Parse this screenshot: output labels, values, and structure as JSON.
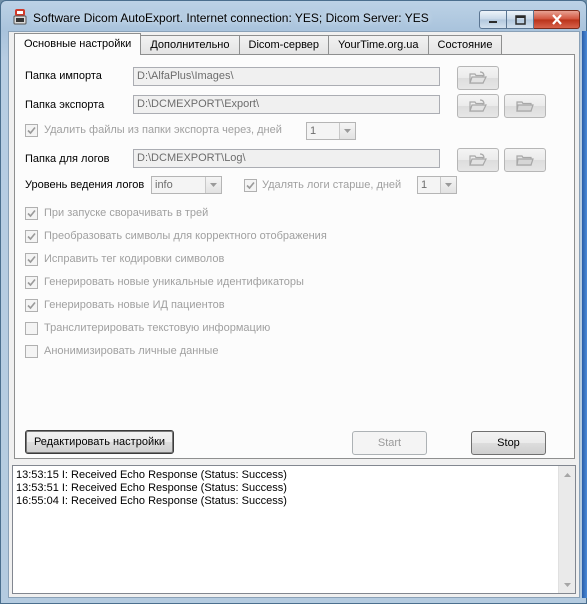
{
  "window": {
    "title": "Software Dicom AutoExport. Internet connection: YES; Dicom Server: YES"
  },
  "tabs": [
    {
      "label": "Основные настройки"
    },
    {
      "label": "Дополнительно"
    },
    {
      "label": "Dicom-сервер"
    },
    {
      "label": "YourTime.org.ua"
    },
    {
      "label": "Состояние"
    }
  ],
  "settings": {
    "import_folder": {
      "label": "Папка импорта",
      "value": "D:\\AlfaPlus\\Images\\"
    },
    "export_folder": {
      "label": "Папка экспорта",
      "value": "D:\\DCMEXPORT\\Export\\"
    },
    "delete_export": {
      "label": "Удалить файлы из папки экспорта через, дней",
      "days": "1",
      "checked": true
    },
    "log_folder": {
      "label": "Папка для логов",
      "value": "D:\\DCMEXPORT\\Log\\"
    },
    "log_level": {
      "label": "Уровень ведения логов",
      "value": "info"
    },
    "delete_logs": {
      "label": "Удалять логи старше, дней",
      "days": "1",
      "checked": true
    },
    "options": [
      {
        "label": "При запуске сворачивать в трей",
        "checked": true
      },
      {
        "label": "Преобразовать символы для корректного отображения",
        "checked": true
      },
      {
        "label": "Исправить тег кодировки символов",
        "checked": true
      },
      {
        "label": "Генерировать новые уникальные идентификаторы",
        "checked": true
      },
      {
        "label": "Генерировать новые ИД пациентов",
        "checked": true
      },
      {
        "label": "Транслитерировать текстовую информацию",
        "checked": false
      },
      {
        "label": "Анонимизировать личные данные",
        "checked": false
      }
    ]
  },
  "buttons": {
    "edit": "Редактировать настройки",
    "start": "Start",
    "stop": "Stop"
  },
  "log": [
    "13:53:15 I: Received Echo Response (Status: Success)",
    "13:53:51 I: Received Echo Response (Status: Success)",
    "16:55:04 I: Received Echo Response (Status: Success)"
  ],
  "icons": {
    "app": "dicom-app-icon",
    "browse": "folder-open-icon",
    "open": "folder-icon"
  }
}
